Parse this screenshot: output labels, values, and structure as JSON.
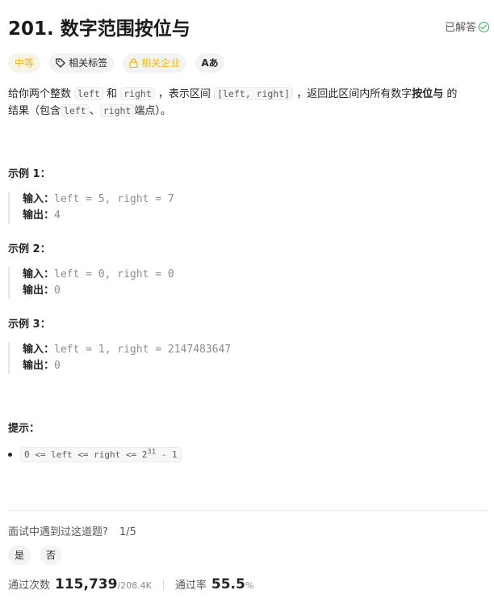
{
  "problem": {
    "title": "201. 数字范围按位与",
    "solved_label": "已解答"
  },
  "tags": {
    "difficulty": "中等",
    "related_tags": "相关标签",
    "related_companies": "相关企业",
    "translate_icon_text": "Aあ"
  },
  "description": {
    "p1_a": "给你两个整数",
    "code_left": "left",
    "p1_b": "和",
    "code_right": "right",
    "p1_c": "，表示区间",
    "code_interval": "[left, right]",
    "p1_d": "，返回此区间内所有数字",
    "bold_and": "按位与",
    "p1_e": "的",
    "p2_a": "结果（包含",
    "p2_b": "、",
    "p2_c": "端点）。"
  },
  "examples": [
    {
      "title": "示例 1：",
      "input_label": "输入：",
      "input": "left = 5, right = 7",
      "output_label": "输出：",
      "output": "4"
    },
    {
      "title": "示例 2：",
      "input_label": "输入：",
      "input": "left = 0, right = 0",
      "output_label": "输出：",
      "output": "0"
    },
    {
      "title": "示例 3：",
      "input_label": "输入：",
      "input": "left = 1, right = 2147483647",
      "output_label": "输出：",
      "output": "0"
    }
  ],
  "hints": {
    "title": "提示：",
    "constraint_prefix": "0 <= left <= right <= 2",
    "constraint_sup": "31",
    "constraint_suffix": " - 1"
  },
  "interview": {
    "question": "面试中遇到过这道题?",
    "count": "1/5",
    "yes": "是",
    "no": "否"
  },
  "stats": {
    "accepted_label": "通过次数",
    "accepted_value": "115,739",
    "submissions": "/208.4K",
    "rate_label": "通过率",
    "rate_value": "55.5",
    "rate_unit": "%"
  },
  "colors": {
    "medium": "#ffb800",
    "solved": "#2db55d"
  }
}
